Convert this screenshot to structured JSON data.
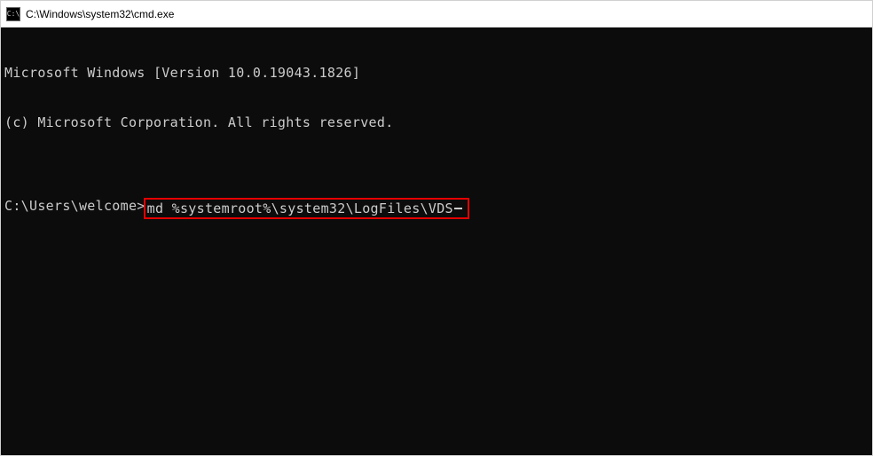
{
  "titlebar": {
    "icon_label": "cmd-icon",
    "title": "C:\\Windows\\system32\\cmd.exe"
  },
  "terminal": {
    "line_version": "Microsoft Windows [Version 10.0.19043.1826]",
    "line_copyright": "(c) Microsoft Corporation. All rights reserved.",
    "blank": "",
    "prompt": "C:\\Users\\welcome>",
    "command": "md %systemroot%\\system32\\LogFiles\\VDS",
    "highlight_color": "#e60000"
  }
}
